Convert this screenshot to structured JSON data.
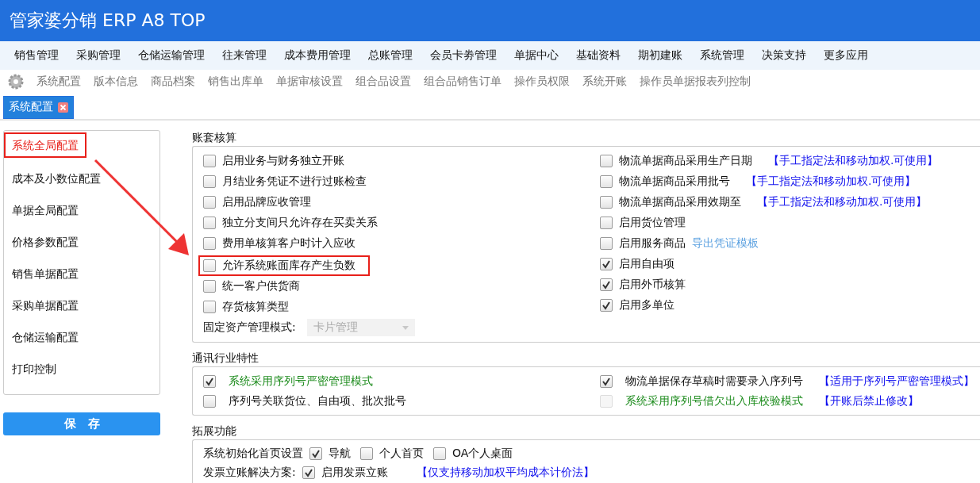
{
  "app": {
    "title": "管家婆分销 ERP A8 TOP"
  },
  "menu": [
    "销售管理",
    "采购管理",
    "仓储运输管理",
    "往来管理",
    "成本费用管理",
    "总账管理",
    "会员卡劵管理",
    "单据中心",
    "基础资料",
    "期初建账",
    "系统管理",
    "决策支持",
    "更多应用"
  ],
  "toolbar": [
    "系统配置",
    "版本信息",
    "商品档案",
    "销售出库单",
    "单据审核设置",
    "组合品设置",
    "组合品销售订单",
    "操作员权限",
    "系统开账",
    "操作员单据报表列控制"
  ],
  "tabs": [
    {
      "label": "系统配置",
      "selected": true
    }
  ],
  "sidebar": {
    "items": [
      {
        "label": "系统全局配置",
        "selected": true
      },
      {
        "label": "成本及小数位配置",
        "selected": false
      },
      {
        "label": "单据全局配置",
        "selected": false
      },
      {
        "label": "价格参数配置",
        "selected": false
      },
      {
        "label": "销售单据配置",
        "selected": false
      },
      {
        "label": "采购单据配置",
        "selected": false
      },
      {
        "label": "仓储运输配置",
        "selected": false
      },
      {
        "label": "打印控制",
        "selected": false
      }
    ]
  },
  "save_button": "保　存",
  "accounting": {
    "title": "账套核算",
    "left": [
      {
        "label": "启用业务与财务独立开账",
        "checked": false,
        "highlighted": false
      },
      {
        "label": "月结业务凭证不进行过账检查",
        "checked": false,
        "highlighted": false
      },
      {
        "label": "启用品牌应收管理",
        "checked": false,
        "highlighted": false
      },
      {
        "label": "独立分支间只允许存在买卖关系",
        "checked": false,
        "highlighted": false
      },
      {
        "label": "费用单核算客户时计入应收",
        "checked": false,
        "highlighted": false
      },
      {
        "label": "允许系统账面库存产生负数",
        "checked": false,
        "highlighted": true
      },
      {
        "label": "统一客户供货商",
        "checked": false,
        "highlighted": false
      },
      {
        "label": "存货核算类型",
        "checked": false,
        "highlighted": false
      }
    ],
    "select": {
      "label": "固定资产管理模式:",
      "value": "卡片管理"
    },
    "right": [
      {
        "label": "物流单据商品采用生产日期",
        "checked": false,
        "note": "【手工指定法和移动加权.可使用】"
      },
      {
        "label": "物流单据商品采用批号",
        "checked": false,
        "note": "【手工指定法和移动加权.可使用】"
      },
      {
        "label": "物流单据商品采用效期至",
        "checked": false,
        "note": "【手工指定法和移动加权.可使用】"
      },
      {
        "label": "启用货位管理",
        "checked": false
      },
      {
        "label": "启用服务商品",
        "checked": false,
        "link": "导出凭证模板"
      },
      {
        "label": "启用自由项",
        "checked": true
      },
      {
        "label": "启用外币核算",
        "checked": true
      },
      {
        "label": "启用多单位",
        "checked": true
      }
    ]
  },
  "telecom": {
    "title": "通讯行业特性",
    "left": [
      {
        "label": "系统采用序列号严密管理模式",
        "checked": true,
        "disabled": false,
        "color": "#1a8a1a"
      },
      {
        "label": "序列号关联货位、自由项、批次批号",
        "checked": false,
        "disabled": false,
        "color": "#111111"
      }
    ],
    "right": [
      {
        "label": "物流单据保存草稿时需要录入序列号",
        "checked": true,
        "disabled": false,
        "color": "#111111",
        "note": "【适用于序列号严密管理模式】"
      },
      {
        "label": "系统采用序列号借欠出入库校验模式",
        "checked": false,
        "disabled": true,
        "color": "#1a8a1a",
        "note": "【开账后禁止修改】"
      }
    ]
  },
  "extension": {
    "title": "拓展功能",
    "rows": [
      {
        "label": "系统初始化首页设置",
        "options": [
          {
            "label": "导航",
            "checked": true
          },
          {
            "label": "个人首页",
            "checked": false
          },
          {
            "label": "OA个人桌面",
            "checked": false
          }
        ]
      },
      {
        "label": "发票立账解决方案:",
        "options": [
          {
            "label": "启用发票立账",
            "checked": true
          }
        ],
        "note": "【仅支持移动加权平均成本计价法】"
      }
    ]
  }
}
